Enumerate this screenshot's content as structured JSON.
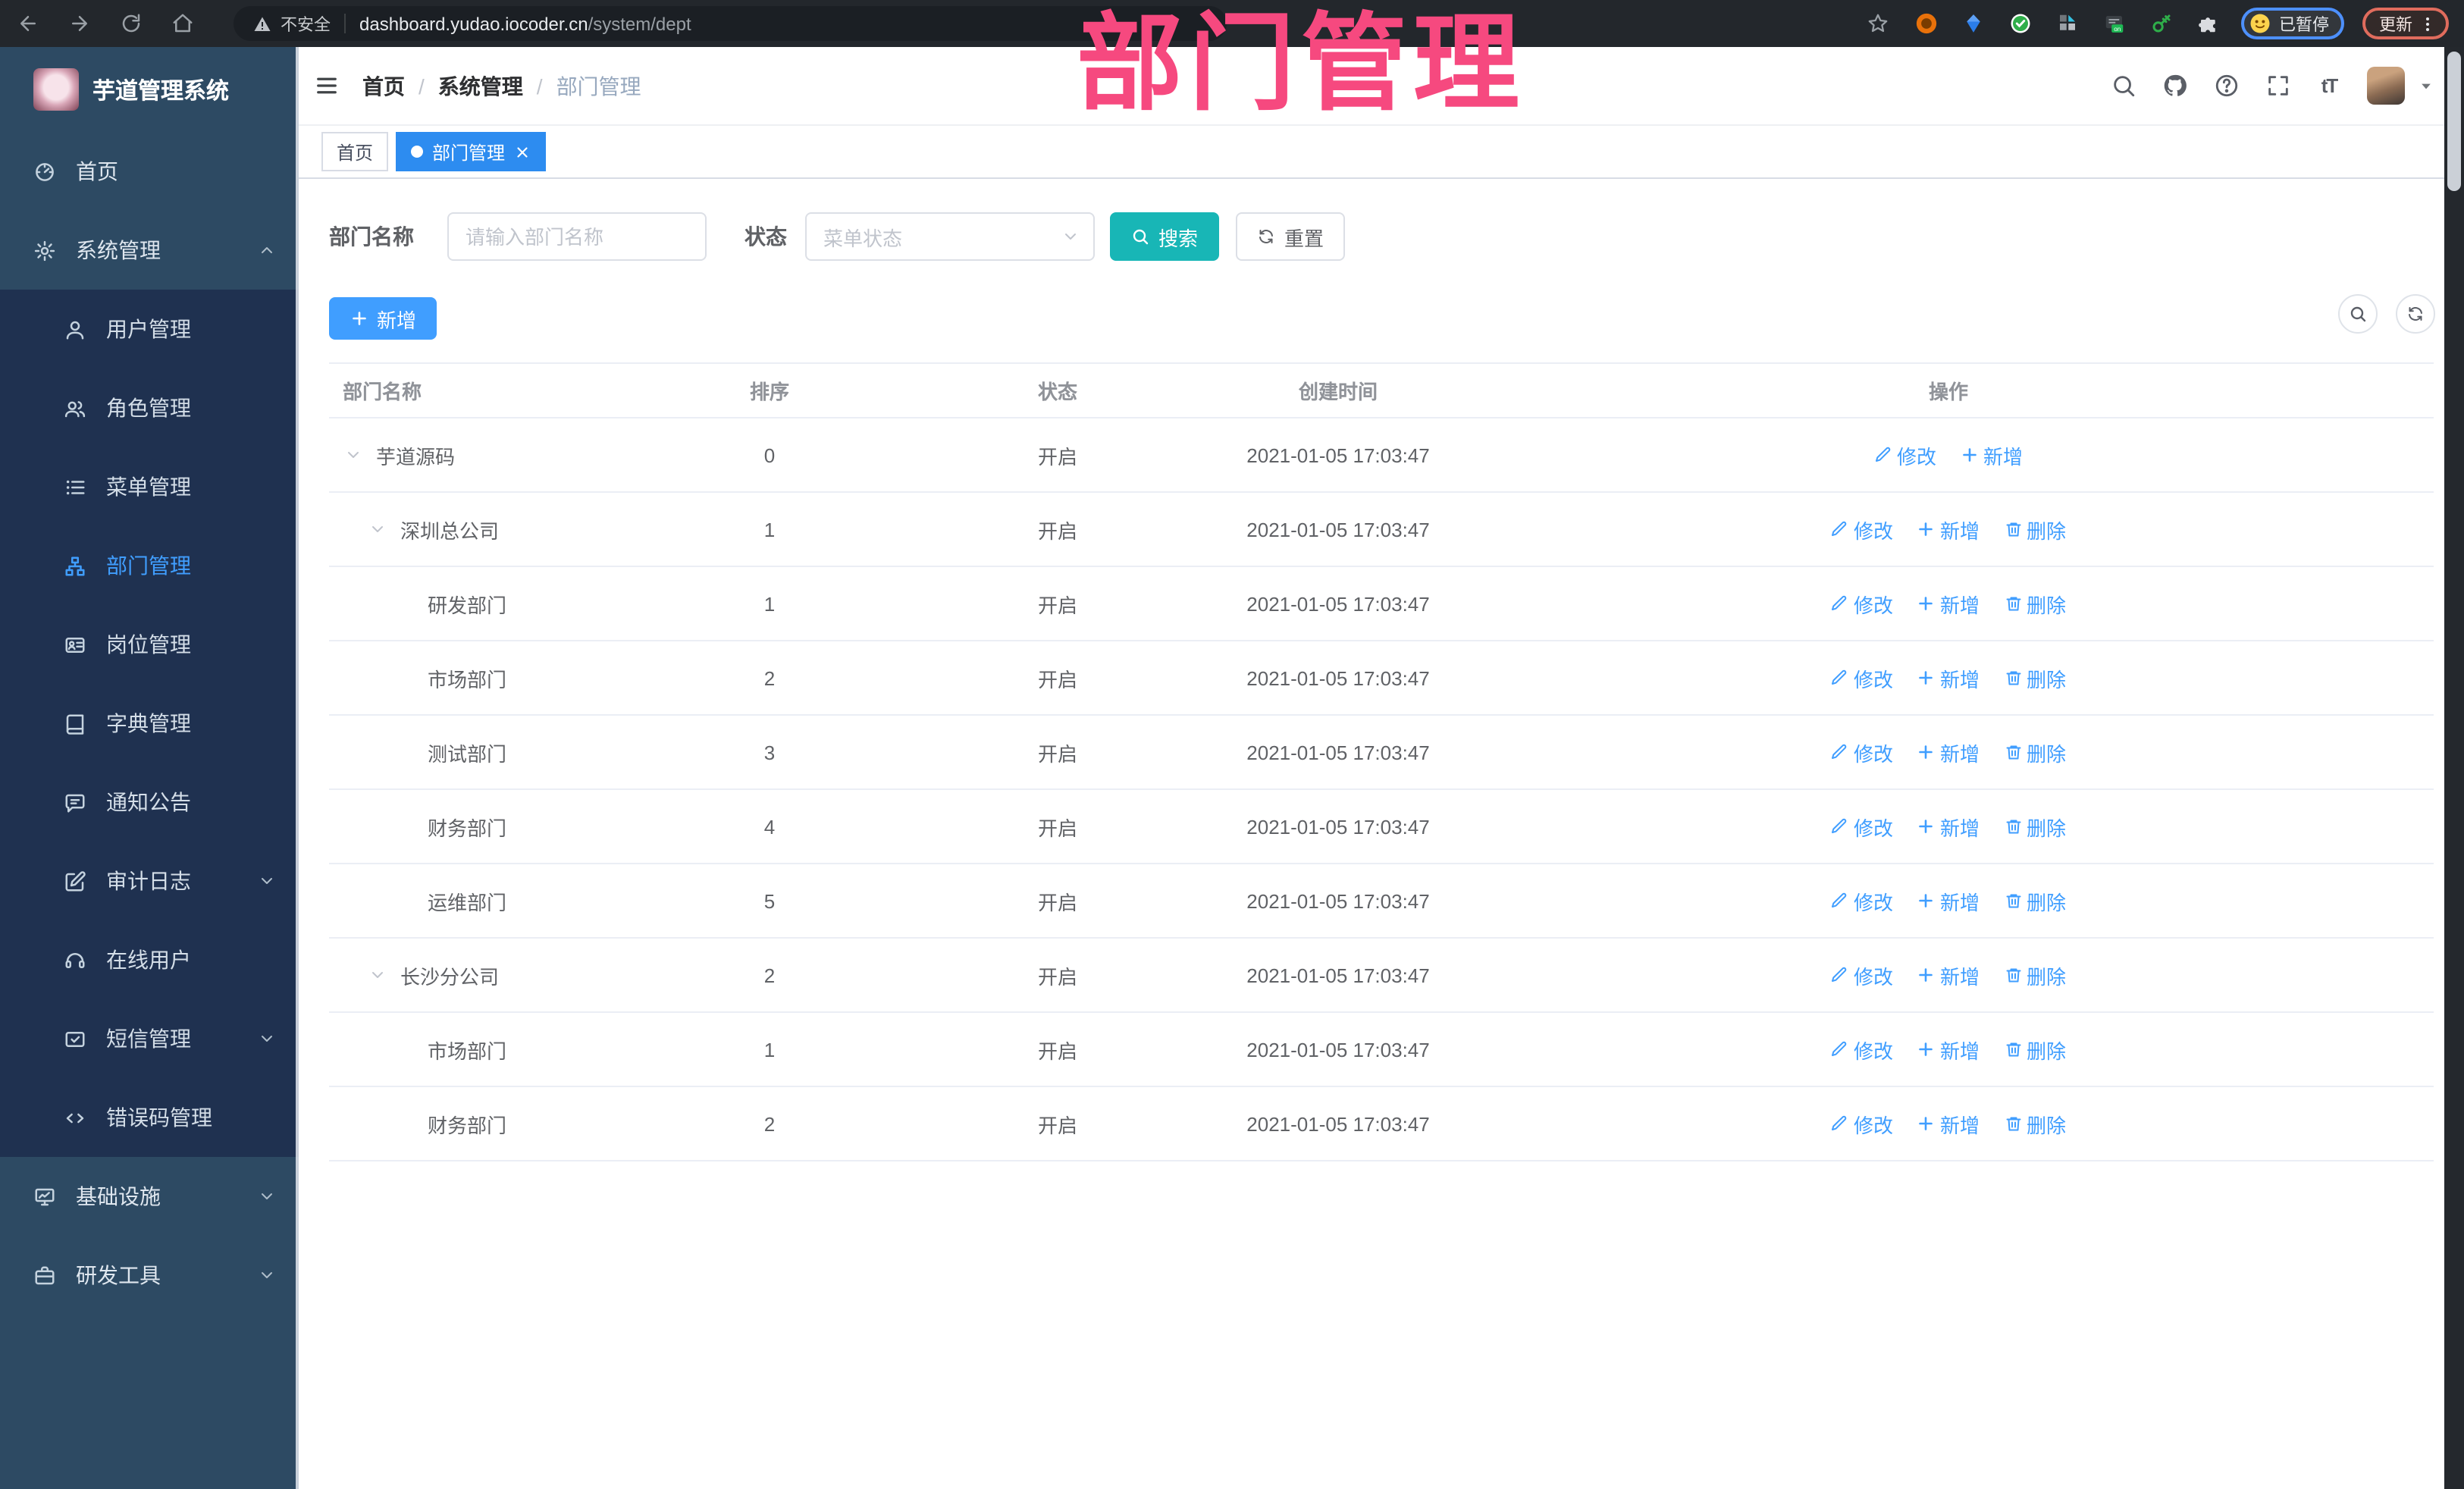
{
  "colors": {
    "primary": "#409eff",
    "search_button": "#18b6b6",
    "active_tab": "#2d8cf0",
    "annotation": "#f6497f",
    "sidebar_bg": "#2d4a63",
    "submenu_bg": "#1f3150"
  },
  "annotation": {
    "text": "部门管理"
  },
  "chrome": {
    "security_label": "不安全",
    "url_domain": "dashboard.yudao.iocoder.cn",
    "url_path": "/system/dept",
    "nav_icons": [
      "back-arrow-icon",
      "forward-arrow-icon",
      "reload-icon",
      "home-icon"
    ],
    "extension_icons": [
      "ext-orange-icon",
      "ext-gem-icon",
      "ext-green-check-icon",
      "ext-squares-icon",
      "ext-onoff-icon",
      "ext-key-icon",
      "ext-puzzle-icon"
    ],
    "profile_status": "已暂停",
    "update_label": "更新"
  },
  "sidebar": {
    "logo_title": "芋道管理系统",
    "menu": [
      {
        "label": "首页",
        "icon": "dashboard-icon",
        "type": "top"
      },
      {
        "label": "系统管理",
        "icon": "gear-icon",
        "type": "top",
        "caret": "up",
        "children": [
          {
            "label": "用户管理",
            "icon": "user-icon"
          },
          {
            "label": "角色管理",
            "icon": "users-icon"
          },
          {
            "label": "菜单管理",
            "icon": "menu-icon"
          },
          {
            "label": "部门管理",
            "icon": "org-icon",
            "active": true
          },
          {
            "label": "岗位管理",
            "icon": "badge-icon"
          },
          {
            "label": "字典管理",
            "icon": "book-icon"
          },
          {
            "label": "通知公告",
            "icon": "announce-icon"
          },
          {
            "label": "审计日志",
            "icon": "log-icon",
            "caret": "down"
          },
          {
            "label": "在线用户",
            "icon": "online-icon"
          },
          {
            "label": "短信管理",
            "icon": "sms-icon",
            "caret": "down"
          },
          {
            "label": "错误码管理",
            "icon": "code-icon"
          }
        ]
      },
      {
        "label": "基础设施",
        "icon": "infra-icon",
        "type": "top",
        "caret": "down"
      },
      {
        "label": "研发工具",
        "icon": "tools-icon",
        "type": "top",
        "caret": "down"
      }
    ]
  },
  "header": {
    "breadcrumb": [
      "首页",
      "系统管理",
      "部门管理"
    ],
    "icons": [
      "search-icon",
      "github-icon",
      "help-icon",
      "fullscreen-icon",
      "font-size-icon"
    ]
  },
  "tabs": [
    {
      "label": "首页",
      "active": false
    },
    {
      "label": "部门管理",
      "active": true,
      "closable": true
    }
  ],
  "filters": {
    "name_label": "部门名称",
    "name_placeholder": "请输入部门名称",
    "status_label": "状态",
    "status_placeholder": "菜单状态",
    "search_label": "搜索",
    "reset_label": "重置"
  },
  "toolbar": {
    "add_label": "新增"
  },
  "table": {
    "columns": [
      "部门名称",
      "排序",
      "状态",
      "创建时间",
      "操作"
    ],
    "action_labels": {
      "edit": "修改",
      "add": "新增",
      "delete": "删除"
    },
    "rows": [
      {
        "name": "芋道源码",
        "level": 0,
        "expandable": true,
        "sort": "0",
        "status": "开启",
        "created": "2021-01-05 17:03:47",
        "actions": [
          "edit",
          "add"
        ]
      },
      {
        "name": "深圳总公司",
        "level": 1,
        "expandable": true,
        "sort": "1",
        "status": "开启",
        "created": "2021-01-05 17:03:47",
        "actions": [
          "edit",
          "add",
          "delete"
        ]
      },
      {
        "name": "研发部门",
        "level": 2,
        "expandable": false,
        "sort": "1",
        "status": "开启",
        "created": "2021-01-05 17:03:47",
        "actions": [
          "edit",
          "add",
          "delete"
        ]
      },
      {
        "name": "市场部门",
        "level": 2,
        "expandable": false,
        "sort": "2",
        "status": "开启",
        "created": "2021-01-05 17:03:47",
        "actions": [
          "edit",
          "add",
          "delete"
        ]
      },
      {
        "name": "测试部门",
        "level": 2,
        "expandable": false,
        "sort": "3",
        "status": "开启",
        "created": "2021-01-05 17:03:47",
        "actions": [
          "edit",
          "add",
          "delete"
        ]
      },
      {
        "name": "财务部门",
        "level": 2,
        "expandable": false,
        "sort": "4",
        "status": "开启",
        "created": "2021-01-05 17:03:47",
        "actions": [
          "edit",
          "add",
          "delete"
        ]
      },
      {
        "name": "运维部门",
        "level": 2,
        "expandable": false,
        "sort": "5",
        "status": "开启",
        "created": "2021-01-05 17:03:47",
        "actions": [
          "edit",
          "add",
          "delete"
        ]
      },
      {
        "name": "长沙分公司",
        "level": 1,
        "expandable": true,
        "sort": "2",
        "status": "开启",
        "created": "2021-01-05 17:03:47",
        "actions": [
          "edit",
          "add",
          "delete"
        ]
      },
      {
        "name": "市场部门",
        "level": 2,
        "expandable": false,
        "sort": "1",
        "status": "开启",
        "created": "2021-01-05 17:03:47",
        "actions": [
          "edit",
          "add",
          "delete"
        ]
      },
      {
        "name": "财务部门",
        "level": 2,
        "expandable": false,
        "sort": "2",
        "status": "开启",
        "created": "2021-01-05 17:03:47",
        "actions": [
          "edit",
          "add",
          "delete"
        ]
      }
    ]
  }
}
